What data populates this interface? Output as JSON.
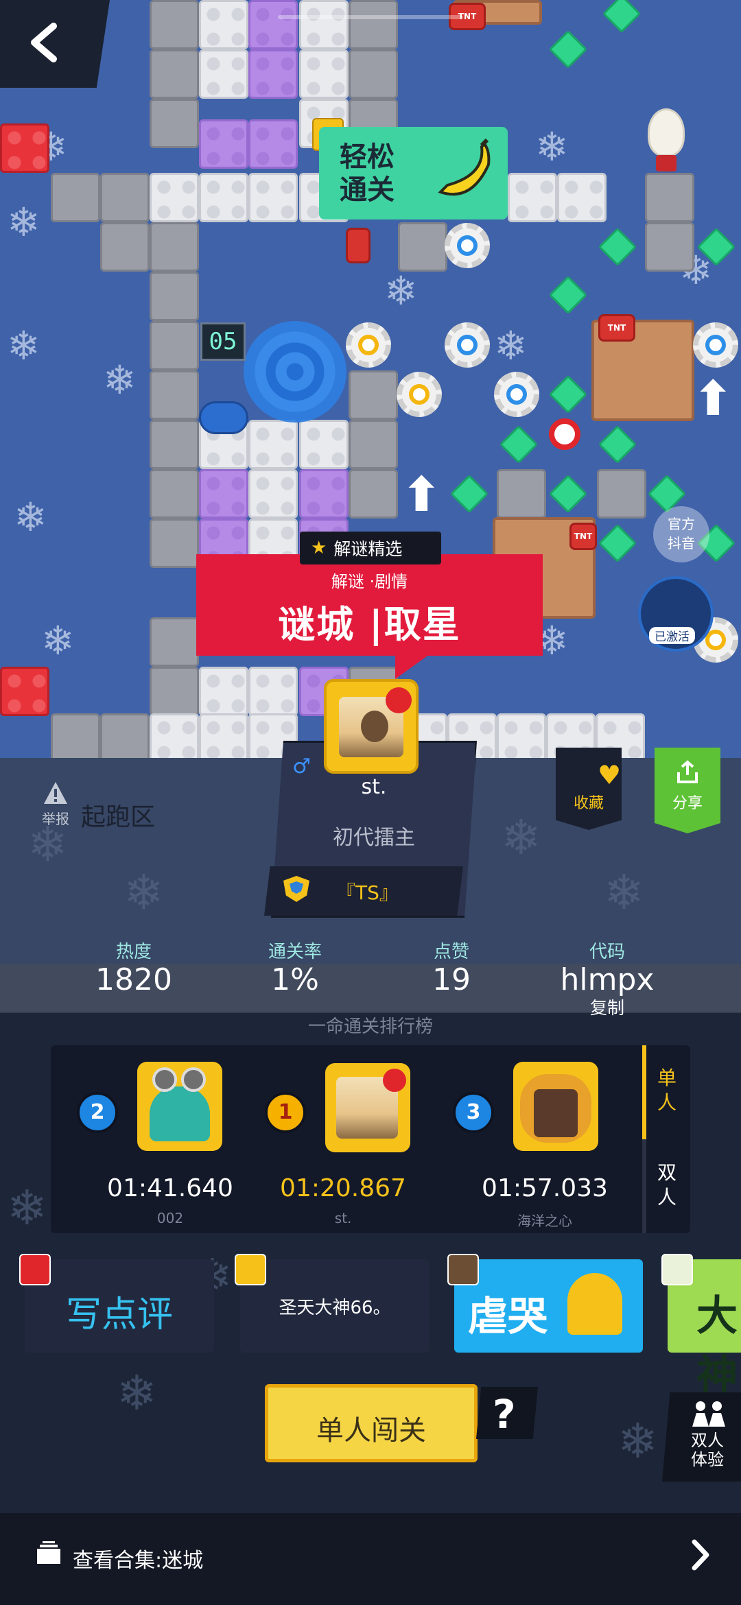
{
  "scene": {
    "easy_tag": "轻松\n通关",
    "featured_badge": "解谜精选",
    "category": "解谜 ·剧情",
    "title": "谜城 |取星",
    "tile_number": "05",
    "official_badge": "官方\n抖音",
    "activated_badge": "已激活"
  },
  "author": {
    "name": "st.",
    "role": "初代擂主",
    "team": "『TS』"
  },
  "actions": {
    "report": "举报",
    "zone": "起跑区",
    "favorite": "收藏",
    "share": "分享"
  },
  "stats": {
    "heat_label": "热度",
    "heat": "1820",
    "pass_label": "通关率",
    "pass": "1%",
    "likes_label": "点赞",
    "likes": "19",
    "code_label": "代码",
    "code": "hlmpx",
    "copy": "复制"
  },
  "leaderboard": {
    "title": "一命通关排行榜",
    "entries": [
      {
        "rank": "2",
        "time": "01:41.640",
        "name": "002"
      },
      {
        "rank": "1",
        "time": "01:20.867",
        "name": "st."
      },
      {
        "rank": "3",
        "time": "01:57.033",
        "name": "海洋之心"
      }
    ],
    "tab_single": "单人",
    "tab_duo": "双人"
  },
  "reviews": {
    "write": "写点评",
    "user": "圣天大神66。",
    "cry": "虐哭",
    "big": "大神"
  },
  "play": {
    "solo": "单人闯关",
    "help": "?",
    "duo_trial": "双人\n体验"
  },
  "collection": {
    "label": "查看合集:迷城"
  },
  "colors": {
    "accent_yellow": "#f6c21a",
    "featured_red": "#e21b3c",
    "share_green": "#5ec236",
    "panel_bg": "#1d2638"
  }
}
